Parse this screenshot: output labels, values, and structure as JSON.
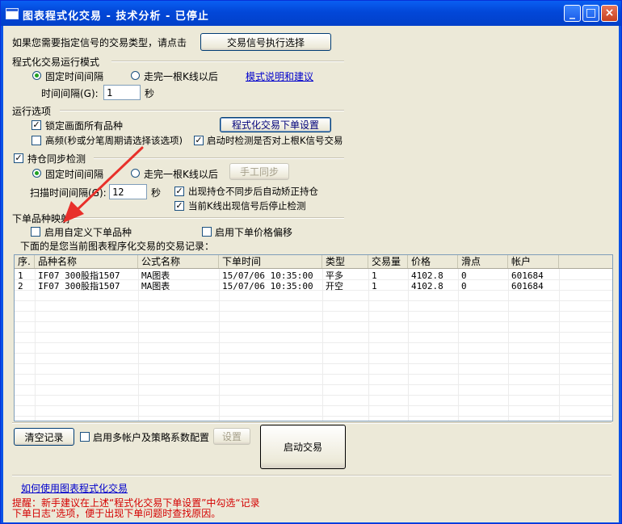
{
  "window": {
    "title": "图表程式化交易 - 技术分析 - 已停止"
  },
  "signal": {
    "prompt": "如果您需要指定信号的交易类型，请点击",
    "button": "交易信号执行选择"
  },
  "mode": {
    "group": "程式化交易运行模式",
    "fixed": "固定时间间隔",
    "bar": "走完一根K线以后",
    "link": "模式说明和建议",
    "interval_label": "时间间隔(G):",
    "interval_value": "1",
    "unit": "秒"
  },
  "options": {
    "group": "运行选项",
    "lock": "锁定画面所有品种",
    "order_button": "程式化交易下单设置",
    "high_freq": "高频(秒或分笔周期请选择该选项)",
    "check_signal": "启动时检测是否对上根K信号交易"
  },
  "sync": {
    "group": "持仓同步检测",
    "fixed": "固定时间间隔",
    "bar": "走完一根K线以后",
    "manual_button": "手工同步",
    "interval_label": "扫描时间间隔(G):",
    "interval_value": "12",
    "unit": "秒",
    "auto_fix": "出现持仓不同步后自动矫正持仓",
    "stop_check": "当前K线出现信号后停止检测"
  },
  "mapping": {
    "group": "下单品种映射",
    "custom": "启用自定义下单品种",
    "offset": "启用下单价格偏移"
  },
  "records": {
    "caption": "下面的是您当前图表程序化交易的交易记录：",
    "columns": [
      "序.",
      "品种名称",
      "公式名称",
      "下单时间",
      "类型",
      "交易量",
      "价格",
      "滑点",
      "帐户"
    ],
    "rows": [
      [
        "1",
        "IF07 300股指1507",
        "MA图表",
        "15/07/06 10:35:00",
        "平多",
        "1",
        "4102.8",
        "0",
        "601684"
      ],
      [
        "2",
        "IF07 300股指1507",
        "MA图表",
        "15/07/06 10:35:00",
        "开空",
        "1",
        "4102.8",
        "0",
        "601684"
      ]
    ]
  },
  "bottom": {
    "clear": "清空记录",
    "multi": "启用多帐户及策略系数配置",
    "settings": "设置",
    "start": "启动交易",
    "help_link": "如何使用图表程式化交易",
    "tip_line1": "提醒：新手建议在上述“程式化交易下单设置”中勾选“记录",
    "tip_line2": "下单日志”选项，便于出现下单问题时查找原因。"
  },
  "colors": {
    "title_bar": "#0a53e6",
    "face": "#ece9d8",
    "arrow": "#e8302a",
    "tip": "#d40000",
    "link": "#0000cc"
  }
}
